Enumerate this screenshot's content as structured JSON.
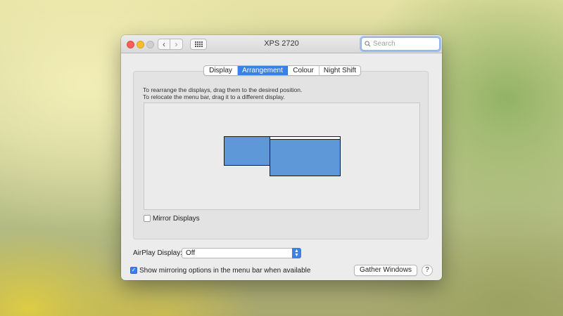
{
  "window": {
    "title": "XPS 2720",
    "search_placeholder": "Search"
  },
  "tabs": [
    {
      "label": "Display",
      "active": false
    },
    {
      "label": "Arrangement",
      "active": true
    },
    {
      "label": "Colour",
      "active": false
    },
    {
      "label": "Night Shift",
      "active": false
    }
  ],
  "arrangement": {
    "instruction_line1": "To rearrange the displays, drag them to the desired position.",
    "instruction_line2": "To relocate the menu bar, drag it to a different display.",
    "mirror_label": "Mirror Displays",
    "mirror_checked": false
  },
  "airplay": {
    "label": "AirPlay Display:",
    "value": "Off"
  },
  "mirroring_option": {
    "label": "Show mirroring options in the menu bar when available",
    "checked": true
  },
  "buttons": {
    "gather": "Gather Windows",
    "help": "?"
  },
  "colors": {
    "accent": "#3c7fe8",
    "display_fill": "#5f98d8"
  }
}
